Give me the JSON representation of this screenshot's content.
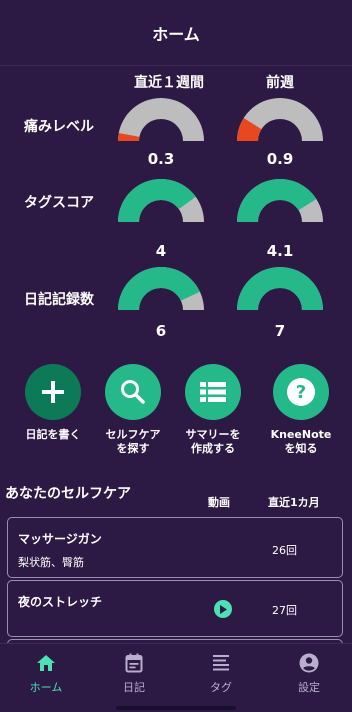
{
  "header": {
    "title": "ホーム"
  },
  "stats": {
    "columns": [
      "直近１週間",
      "前週"
    ],
    "rows": [
      {
        "label": "痛みレベル",
        "values": [
          "0.3",
          "0.9"
        ],
        "fractions": [
          0.06,
          0.18
        ],
        "color": "#e8481d"
      },
      {
        "label": "タグスコア",
        "values": [
          "4",
          "4.1"
        ],
        "fractions": [
          0.8,
          0.82
        ],
        "color": "#25b889"
      },
      {
        "label": "日記記録数",
        "values": [
          "6",
          "7"
        ],
        "fractions": [
          0.86,
          1.0
        ],
        "color": "#25b889"
      }
    ],
    "track_color": "#bdbdbd"
  },
  "actions": [
    {
      "label_1": "日記を書く",
      "label_2": "",
      "icon": "plus-icon"
    },
    {
      "label_1": "セルフケア",
      "label_2": "を探す",
      "icon": "search-icon"
    },
    {
      "label_1": "サマリーを",
      "label_2": "作成する",
      "icon": "list-icon"
    },
    {
      "label_1": "KneeNote",
      "label_2": "を知る",
      "icon": "help-icon"
    }
  ],
  "selfcare": {
    "title": "あなたのセルフケア",
    "col_video": "動画",
    "col_month": "直近1カ月",
    "items": [
      {
        "name": "マッサージガン",
        "sub": "梨状筋、臀筋",
        "count": "26回",
        "has_video": false
      },
      {
        "name": "夜のストレッチ",
        "sub": "",
        "count": "27回",
        "has_video": true
      }
    ]
  },
  "nav": [
    {
      "label": "ホーム",
      "icon": "home-icon",
      "active": true
    },
    {
      "label": "日記",
      "icon": "calendar-icon",
      "active": false
    },
    {
      "label": "タグ",
      "icon": "notes-icon",
      "active": false
    },
    {
      "label": "設定",
      "icon": "account-icon",
      "active": false
    }
  ],
  "colors": {
    "background": "#2c1a44",
    "accent": "#25b889",
    "active_nav": "#4de0b3",
    "pain": "#e8481d"
  }
}
